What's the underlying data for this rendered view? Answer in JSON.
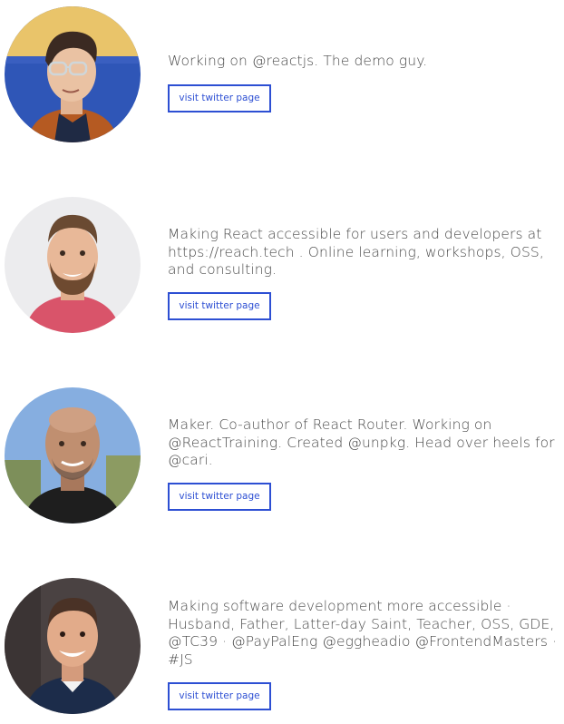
{
  "profiles": [
    {
      "bio": "Working on @reactjs. The demo guy.",
      "button_label": "visit twitter page",
      "avatar_icon": "person-avatar-icon"
    },
    {
      "bio": "Making React accessible for users and developers at https://reach.tech . Online learning, workshops, OSS, and consulting.",
      "button_label": "visit twitter page",
      "avatar_icon": "person-avatar-icon"
    },
    {
      "bio": "Maker. Co-author of React Router. Working on @ReactTraining. Created @unpkg. Head over heels for @cari.",
      "button_label": "visit twitter page",
      "avatar_icon": "person-avatar-icon"
    },
    {
      "bio": "Making software development more accessible · Husband, Father, Latter-day Saint, Teacher, OSS, GDE, @TC39 · @PayPalEng @eggheadio @FrontendMasters · #JS",
      "button_label": "visit twitter page",
      "avatar_icon": "person-avatar-icon"
    }
  ],
  "colors": {
    "accent": "#2d4fd3",
    "text": "#4a4a4a"
  }
}
